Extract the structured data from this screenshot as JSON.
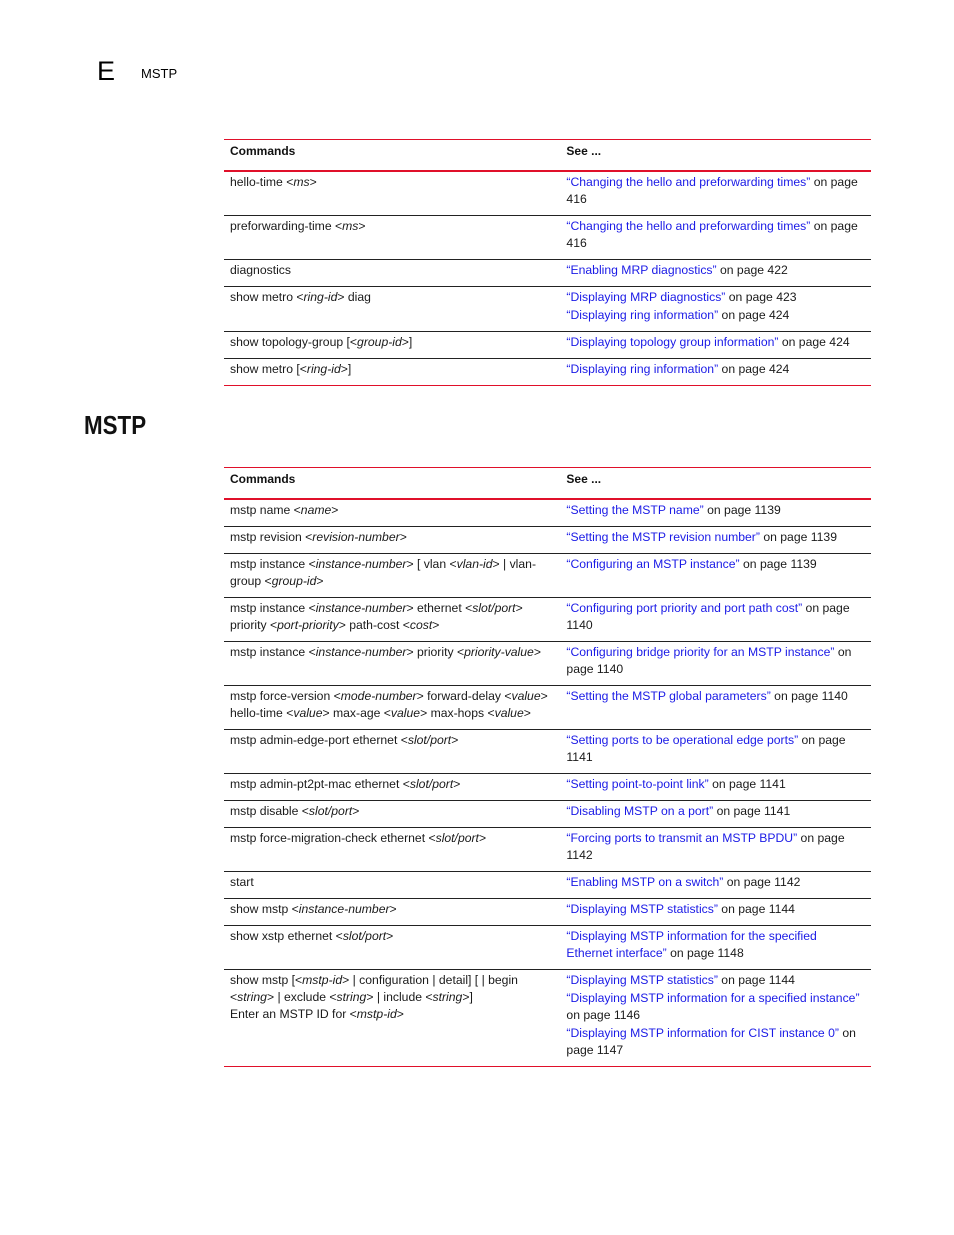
{
  "header": {
    "chapter_letter": "E",
    "chapter_title": "MSTP"
  },
  "section_heading": "MSTP",
  "tables": [
    {
      "columns": [
        "Commands",
        "See ..."
      ],
      "rows": [
        {
          "command": [
            [
              "hello-time <",
              false
            ],
            [
              "ms",
              true
            ],
            [
              ">",
              false
            ]
          ],
          "refs": [
            {
              "link": "“Changing the hello and preforwarding times”",
              "suffix": " on page 416"
            }
          ]
        },
        {
          "command": [
            [
              "preforwarding-time <",
              false
            ],
            [
              "ms",
              true
            ],
            [
              ">",
              false
            ]
          ],
          "refs": [
            {
              "link": "“Changing the hello and preforwarding times”",
              "suffix": " on page 416"
            }
          ]
        },
        {
          "command": [
            [
              "diagnostics",
              false
            ]
          ],
          "refs": [
            {
              "link": "“Enabling MRP diagnostics”",
              "suffix": " on page 422"
            }
          ]
        },
        {
          "command": [
            [
              "show metro <",
              false
            ],
            [
              "ring-id",
              true
            ],
            [
              "> diag",
              false
            ]
          ],
          "refs": [
            {
              "link": "“Displaying MRP diagnostics”",
              "suffix": " on page 423"
            },
            {
              "link": "“Displaying ring information”",
              "suffix": " on page 424"
            }
          ]
        },
        {
          "command": [
            [
              "show topology-group [<",
              false
            ],
            [
              "group-id",
              true
            ],
            [
              ">]",
              false
            ]
          ],
          "refs": [
            {
              "link": "“Displaying topology group information”",
              "suffix": " on page 424"
            }
          ]
        },
        {
          "command": [
            [
              "show metro [<",
              false
            ],
            [
              "ring-id",
              true
            ],
            [
              ">]",
              false
            ]
          ],
          "refs": [
            {
              "link": "“Displaying ring information”",
              "suffix": " on page 424"
            }
          ]
        }
      ]
    },
    {
      "columns": [
        "Commands",
        "See ..."
      ],
      "rows": [
        {
          "command": [
            [
              "mstp name <",
              false
            ],
            [
              "name",
              true
            ],
            [
              ">",
              false
            ]
          ],
          "refs": [
            {
              "link": "“Setting the MSTP name”",
              "suffix": " on page 1139"
            }
          ]
        },
        {
          "command": [
            [
              "mstp revision <",
              false
            ],
            [
              "revision-number",
              true
            ],
            [
              ">",
              false
            ]
          ],
          "refs": [
            {
              "link": "“Setting the MSTP revision number”",
              "suffix": " on page 1139"
            }
          ]
        },
        {
          "command": [
            [
              "mstp instance <",
              false
            ],
            [
              "instance-number",
              true
            ],
            [
              "> [ vlan <",
              false
            ],
            [
              "vlan-id",
              true
            ],
            [
              "> | vlan-group <",
              false
            ],
            [
              "group-id",
              true
            ],
            [
              ">",
              false
            ]
          ],
          "refs": [
            {
              "link": "“Configuring an MSTP instance”",
              "suffix": " on page 1139"
            }
          ]
        },
        {
          "command": [
            [
              "mstp instance <",
              false
            ],
            [
              "instance-number",
              true
            ],
            [
              "> ethernet <",
              false
            ],
            [
              "slot/port",
              true
            ],
            [
              "> priority <",
              false
            ],
            [
              "port-priority",
              true
            ],
            [
              ">  path-cost <",
              false
            ],
            [
              "cost",
              true
            ],
            [
              ">",
              false
            ]
          ],
          "refs": [
            {
              "link": "“Configuring port priority and port path cost”",
              "suffix": " on page 1140"
            }
          ]
        },
        {
          "command": [
            [
              "mstp instance <",
              false
            ],
            [
              "instance-number",
              true
            ],
            [
              "> priority <",
              false
            ],
            [
              "priority-value",
              true
            ],
            [
              ">",
              false
            ]
          ],
          "refs": [
            {
              "link": "“Configuring bridge priority for an MSTP instance”",
              "suffix": " on page 1140"
            }
          ]
        },
        {
          "command": [
            [
              "mstp force-version  <",
              false
            ],
            [
              "mode-number",
              true
            ],
            [
              "> forward-delay <",
              false
            ],
            [
              "value",
              true
            ],
            [
              "> hello-time <",
              false
            ],
            [
              "value",
              true
            ],
            [
              "> max-age <",
              false
            ],
            [
              "value",
              true
            ],
            [
              "> max-hops <",
              false
            ],
            [
              "value",
              true
            ],
            [
              ">",
              false
            ]
          ],
          "refs": [
            {
              "link": "“Setting the MSTP global parameters”",
              "suffix": " on page 1140"
            }
          ]
        },
        {
          "command": [
            [
              "mstp admin-edge-port ethernet <",
              false
            ],
            [
              "slot/port",
              true
            ],
            [
              ">",
              false
            ]
          ],
          "refs": [
            {
              "link": "“Setting ports to be operational edge ports”",
              "suffix": " on page 1141"
            }
          ]
        },
        {
          "command": [
            [
              "mstp admin-pt2pt-mac ethernet <",
              false
            ],
            [
              "slot/port",
              true
            ],
            [
              ">",
              false
            ]
          ],
          "refs": [
            {
              "link": "“Setting point-to-point link”",
              "suffix": " on page 1141"
            }
          ]
        },
        {
          "command": [
            [
              "mstp disable <",
              false
            ],
            [
              "slot/port",
              true
            ],
            [
              ">",
              false
            ]
          ],
          "refs": [
            {
              "link": "“Disabling MSTP on a port”",
              "suffix": " on page 1141"
            }
          ]
        },
        {
          "command": [
            [
              " mstp force-migration-check ethernet <",
              false
            ],
            [
              "slot/port",
              true
            ],
            [
              ">",
              false
            ]
          ],
          "refs": [
            {
              "link": "“Forcing ports to transmit an MSTP BPDU”",
              "suffix": " on page 1142"
            }
          ]
        },
        {
          "command": [
            [
              " start",
              false
            ]
          ],
          "refs": [
            {
              "link": "“Enabling MSTP on a switch”",
              "suffix": " on page 1142"
            }
          ]
        },
        {
          "command": [
            [
              "show mstp <",
              false
            ],
            [
              "instance-number",
              true
            ],
            [
              ">",
              false
            ]
          ],
          "refs": [
            {
              "link": "“Displaying MSTP statistics”",
              "suffix": " on page 1144"
            }
          ]
        },
        {
          "command": [
            [
              "show xstp ethernet <",
              false
            ],
            [
              "slot/port",
              true
            ],
            [
              ">",
              false
            ]
          ],
          "refs": [
            {
              "link": "“Displaying MSTP information for the specified Ethernet interface”",
              "suffix": " on page 1148"
            }
          ]
        },
        {
          "command": [
            [
              "show mstp [<",
              false
            ],
            [
              "mstp-id",
              true
            ],
            [
              "> | configuration | detail] [ | begin <",
              false
            ],
            [
              "string",
              true
            ],
            [
              "> | exclude <",
              false
            ],
            [
              "string",
              true
            ],
            [
              "> | include <",
              false
            ],
            [
              "string",
              true
            ],
            [
              ">]",
              false
            ],
            [
              "\n",
              false
            ],
            [
              "Enter an MSTP ID for <",
              false
            ],
            [
              "mstp-id",
              true
            ],
            [
              ">",
              false
            ]
          ],
          "refs": [
            {
              "link": "“Displaying MSTP statistics”",
              "suffix": " on page 1144"
            },
            {
              "link": "“Displaying MSTP information for a specified instance”",
              "suffix": " on page 1146"
            },
            {
              "link": "“Displaying MSTP information for CIST instance 0”",
              "suffix": " on page 1147"
            }
          ]
        }
      ]
    }
  ]
}
